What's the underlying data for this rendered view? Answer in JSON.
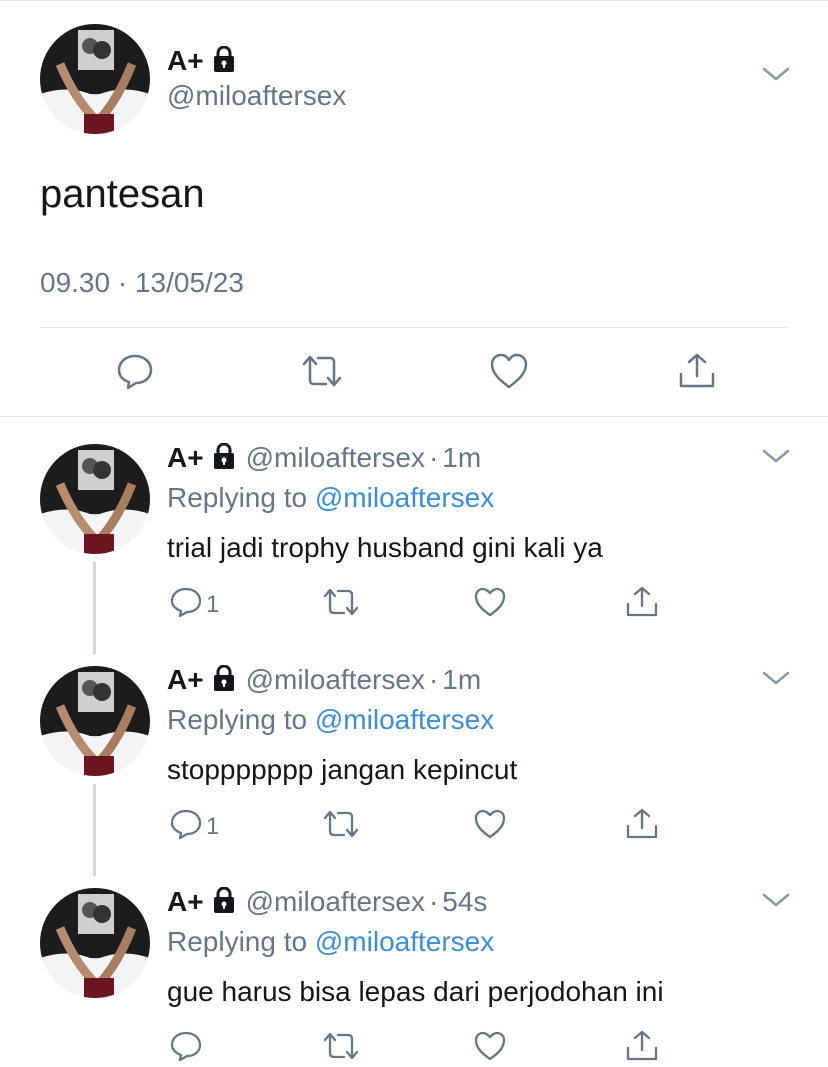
{
  "colors": {
    "text": "#14171a",
    "muted": "#657786",
    "link": "#3b8ed8",
    "divider": "#e1e8ed"
  },
  "main_tweet": {
    "display_name": "A+",
    "handle": "@miloaftersex",
    "text": "pantesan",
    "timestamp": "09.30 · 13/05/23",
    "icons": [
      "lock-icon",
      "chevron-down-icon",
      "reply-icon",
      "retweet-icon",
      "like-icon",
      "share-icon"
    ]
  },
  "replies": [
    {
      "display_name": "A+",
      "handle": "@miloaftersex",
      "separator": "·",
      "age": "1m",
      "replying_prefix": "Replying to",
      "replying_to": "@miloaftersex",
      "text": "trial jadi trophy husband gini kali ya",
      "reply_count": "1"
    },
    {
      "display_name": "A+",
      "handle": "@miloaftersex",
      "separator": "·",
      "age": "1m",
      "replying_prefix": "Replying to",
      "replying_to": "@miloaftersex",
      "text": "stoppppppp jangan kepincut",
      "reply_count": "1"
    },
    {
      "display_name": "A+",
      "handle": "@miloaftersex",
      "separator": "·",
      "age": "54s",
      "replying_prefix": "Replying to",
      "replying_to": "@miloaftersex",
      "text": "gue harus bisa lepas dari perjodohan ini",
      "reply_count": ""
    }
  ]
}
